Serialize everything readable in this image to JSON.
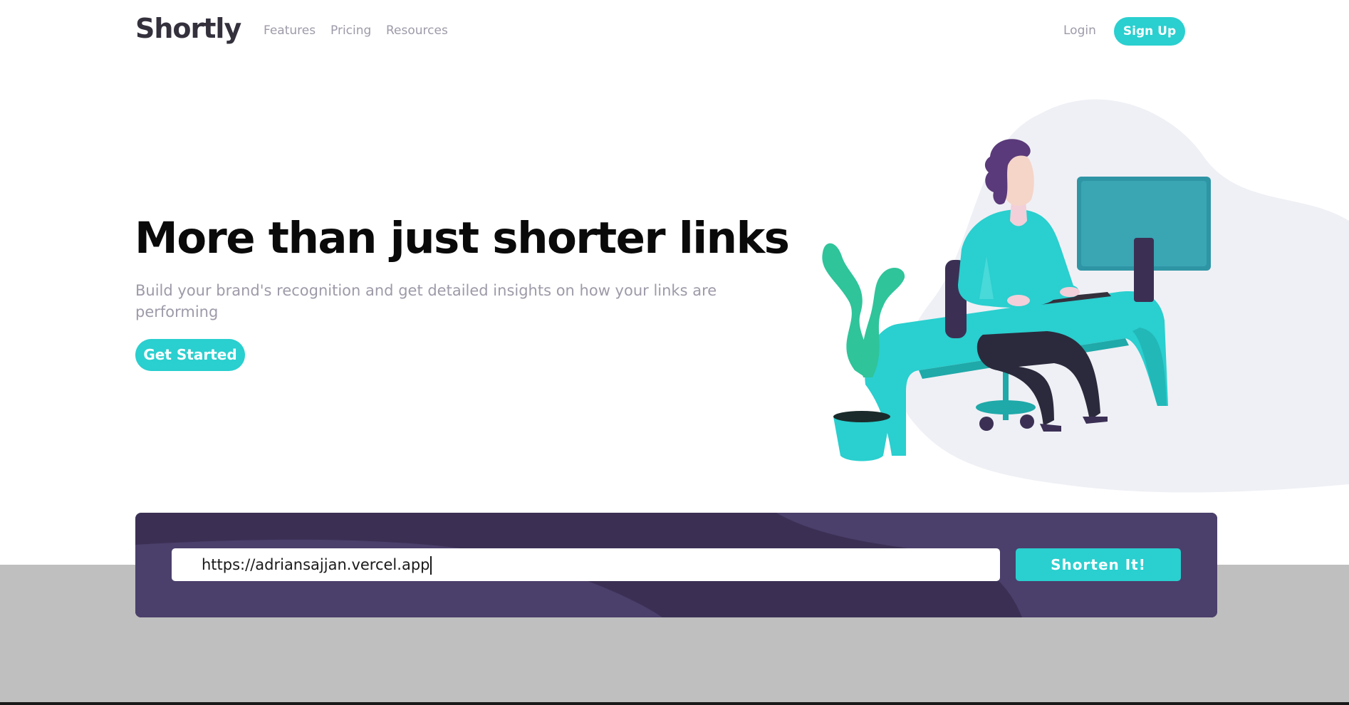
{
  "header": {
    "logo": "Shortly",
    "nav": [
      "Features",
      "Pricing",
      "Resources"
    ],
    "login_label": "Login",
    "signup_label": "Sign Up"
  },
  "hero": {
    "title": "More than just shorter links",
    "subtitle": "Build your brand's recognition and get detailed insights on how your links are performing",
    "cta_label": "Get Started"
  },
  "shorten": {
    "input_value": "https://adriansajjan.vercel.app",
    "button_label": "Shorten It!"
  },
  "colors": {
    "accent": "#2acfcf",
    "dark_violet": "#3b3054",
    "text_gray": "#9e9aa8",
    "heading": "#0a0a0a"
  }
}
